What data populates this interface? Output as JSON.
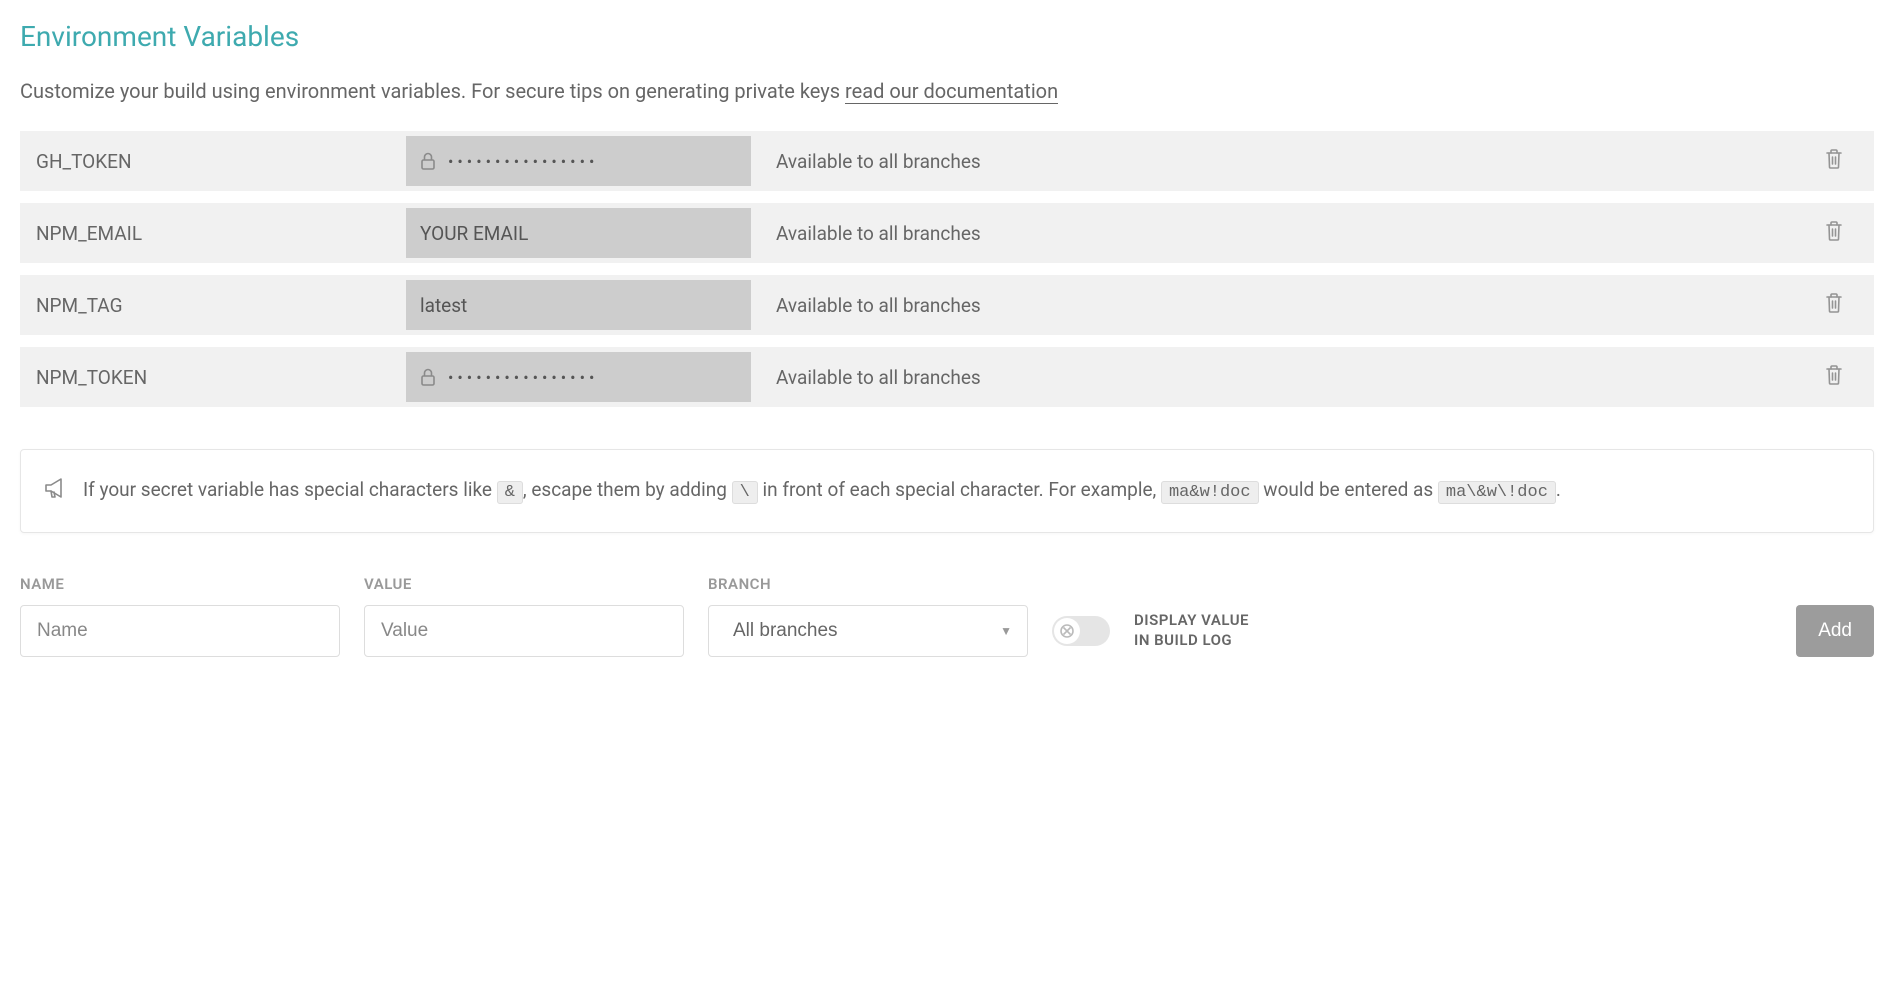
{
  "section": {
    "title": "Environment Variables",
    "description_prefix": "Customize your build using environment variables. For secure tips on generating private keys ",
    "description_link": "read our documentation"
  },
  "env_vars": [
    {
      "name": "GH_TOKEN",
      "secret": true,
      "value": "••••••••••••••••",
      "availability": "Available to all branches"
    },
    {
      "name": "NPM_EMAIL",
      "secret": false,
      "value": "YOUR EMAIL",
      "availability": "Available to all branches"
    },
    {
      "name": "NPM_TAG",
      "secret": false,
      "value": "latest",
      "availability": "Available to all branches"
    },
    {
      "name": "NPM_TOKEN",
      "secret": true,
      "value": "••••••••••••••••",
      "availability": "Available to all branches"
    }
  ],
  "tip": {
    "text_1": "If your secret variable has special characters like ",
    "code_1": "&",
    "text_2": ", escape them by adding ",
    "code_2": "\\",
    "text_3": " in front of each special character. For example, ",
    "code_3": "ma&w!doc",
    "text_4": " would be entered as ",
    "code_4": "ma\\&w\\!doc",
    "text_5": "."
  },
  "form": {
    "name_label": "NAME",
    "name_placeholder": "Name",
    "value_label": "VALUE",
    "value_placeholder": "Value",
    "branch_label": "BRANCH",
    "branch_selected": "All branches",
    "toggle_label_line1": "DISPLAY VALUE",
    "toggle_label_line2": "IN BUILD LOG",
    "toggle_on": false,
    "add_label": "Add"
  }
}
